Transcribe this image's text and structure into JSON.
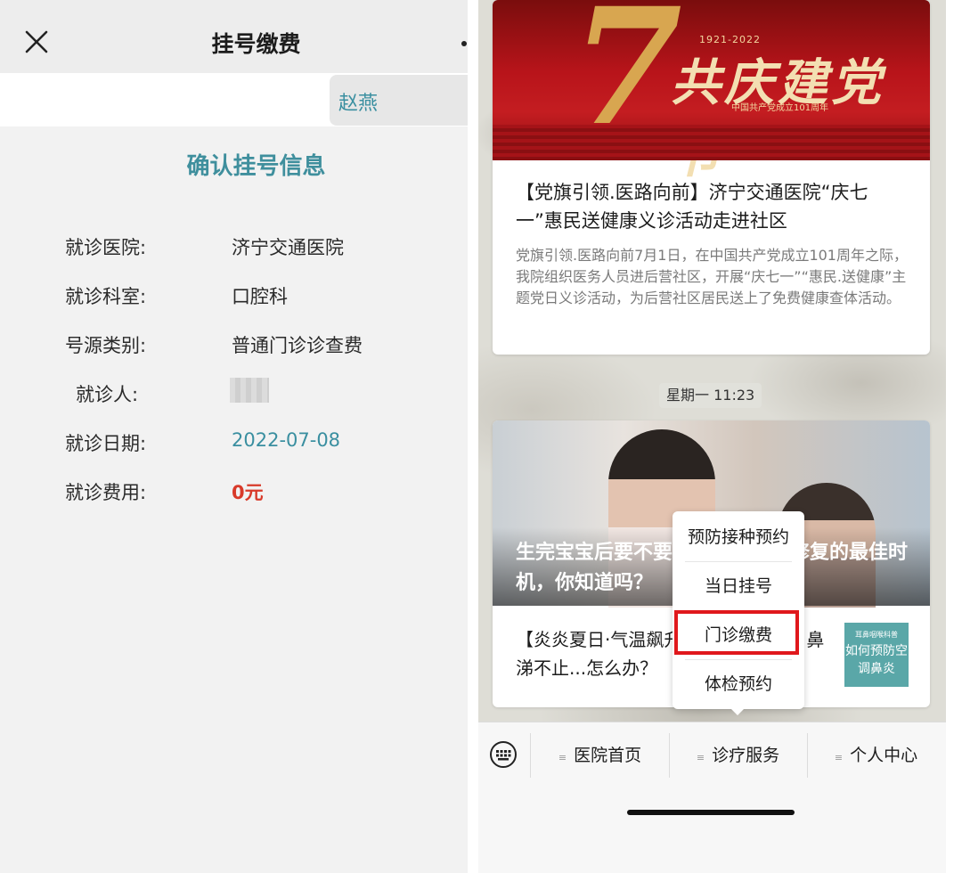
{
  "left": {
    "nav_title": "挂号缴费",
    "user_tab": "赵燕",
    "confirm_title": "确认挂号信息",
    "rows": [
      {
        "label": "就诊医院:",
        "value": "济宁交通医院"
      },
      {
        "label": "就诊科室:",
        "value": "口腔科"
      },
      {
        "label": "号源类别:",
        "value": "普通门诊诊查费"
      },
      {
        "label": "就诊人:",
        "value": ""
      },
      {
        "label": "就诊日期:",
        "value": "2022-07-08"
      },
      {
        "label": "就诊费用:",
        "value": "0元"
      }
    ]
  },
  "right": {
    "banner": {
      "numeral": "7",
      "years": "1921-2022",
      "festival": "共庆建党节",
      "sub": "中国共产党成立101周年"
    },
    "article1": {
      "title": "【党旗引领.医路向前】济宁交通医院“庆七一”惠民送健康义诊活动走进社区",
      "desc": "党旗引领.医路向前7月1日，在中国共产党成立101周年之际，我院组织医务人员进后营社区，开展“庆七一”“惠民.送健康”主题党日义诊活动，为后营社区居民送上了免费健康查体活动。"
    },
    "timestamp": "星期一 11:23",
    "article2": {
      "overlay": "生完宝宝后要不要做盆底修复？修复的最佳时机，你知道吗？",
      "title": "【炎炎夏日·气温飙升】打喷嚏不断、鼻涕不止...怎么办？",
      "thumb_top": "耳鼻咽喉科普",
      "thumb_text": "如何预防空调鼻炎"
    },
    "popup_items": [
      "预防接种预约",
      "当日挂号",
      "门诊缴费",
      "体检预约"
    ],
    "menu": [
      "医院首页",
      "诊疗服务",
      "个人中心"
    ]
  },
  "colors": {
    "accent": "#3f8f9d",
    "fee": "#d83a2a",
    "highlight": "#e0181c"
  }
}
